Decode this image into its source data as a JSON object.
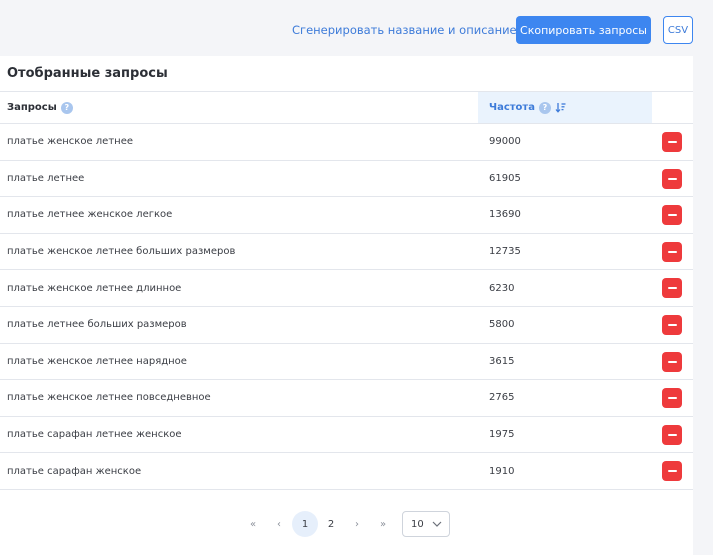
{
  "toolbar": {
    "generate_label": "Сгенерировать название и описание",
    "copy_label": "Скопировать запросы",
    "csv_label": "CSV"
  },
  "panel": {
    "title": "Отобранные запросы"
  },
  "table": {
    "columns": {
      "queries": "Запросы",
      "frequency": "Частота"
    },
    "help_glyph": "?",
    "rows": [
      {
        "query": "платье женское летнее",
        "frequency": "99000"
      },
      {
        "query": "платье летнее",
        "frequency": "61905"
      },
      {
        "query": "платье летнее женское легкое",
        "frequency": "13690"
      },
      {
        "query": "платье женское летнее больших размеров",
        "frequency": "12735"
      },
      {
        "query": "платье женское летнее длинное",
        "frequency": "6230"
      },
      {
        "query": "платье летнее больших размеров",
        "frequency": "5800"
      },
      {
        "query": "платье женское летнее нарядное",
        "frequency": "3615"
      },
      {
        "query": "платье женское летнее повседневное",
        "frequency": "2765"
      },
      {
        "query": "платье сарафан летнее женское",
        "frequency": "1975"
      },
      {
        "query": "платье сарафан женское",
        "frequency": "1910"
      }
    ]
  },
  "pagination": {
    "first": "«",
    "prev": "‹",
    "pages": [
      "1",
      "2"
    ],
    "current_page": "1",
    "next": "›",
    "last": "»",
    "per_page": "10"
  },
  "icons": {
    "help": "help-circle-icon",
    "sort": "sort-descending-icon",
    "delete": "minus-icon",
    "select": "chevron-down-icon"
  },
  "colors": {
    "accent": "#3d86f0",
    "link": "#3d7bd9",
    "danger": "#ee3a3c",
    "header_highlight": "#eaf3fd"
  }
}
